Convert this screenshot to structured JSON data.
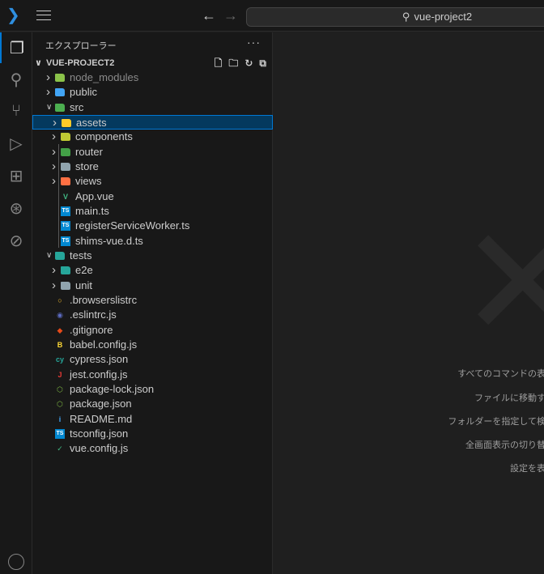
{
  "titlebar": {
    "search_text": "vue-project2",
    "back_icon": "arrow-left-icon",
    "forward_icon": "arrow-right-icon"
  },
  "activity_bar": [
    "explorer-icon",
    "search-icon",
    "source-control-icon",
    "run-debug-icon",
    "extensions-icon",
    "git-graph-icon",
    "remote-icon"
  ],
  "explorer": {
    "title": "エクスプローラー",
    "more": "···",
    "root": "VUE-PROJECT2",
    "items": [
      {
        "label": "node_modules",
        "level": 1,
        "type": "folder",
        "expanded": false,
        "color": "#8bc34a",
        "dim": true
      },
      {
        "label": "public",
        "level": 1,
        "type": "folder",
        "expanded": false,
        "color": "#42a5f5"
      },
      {
        "label": "src",
        "level": 1,
        "type": "folder",
        "expanded": true,
        "color": "#4caf50"
      },
      {
        "label": "assets",
        "level": 2,
        "type": "folder",
        "expanded": false,
        "color": "#ffca28",
        "selected": true
      },
      {
        "label": "components",
        "level": 2,
        "type": "folder",
        "expanded": false,
        "color": "#c0ca33"
      },
      {
        "label": "router",
        "level": 2,
        "type": "folder",
        "expanded": false,
        "color": "#43a047"
      },
      {
        "label": "store",
        "level": 2,
        "type": "folder",
        "expanded": false,
        "color": "#90a4ae"
      },
      {
        "label": "views",
        "level": 2,
        "type": "folder",
        "expanded": false,
        "color": "#ff7043"
      },
      {
        "label": "App.vue",
        "level": 2,
        "type": "file",
        "glyph": "V",
        "color": "#41b883"
      },
      {
        "label": "main.ts",
        "level": 2,
        "type": "file",
        "glyph": "TS",
        "color": "#0288d1"
      },
      {
        "label": "registerServiceWorker.ts",
        "level": 2,
        "type": "file",
        "glyph": "TS",
        "color": "#0288d1"
      },
      {
        "label": "shims-vue.d.ts",
        "level": 2,
        "type": "file",
        "glyph": "TS",
        "color": "#0288d1"
      },
      {
        "label": "tests",
        "level": 1,
        "type": "folder",
        "expanded": true,
        "color": "#26a69a"
      },
      {
        "label": "e2e",
        "level": 2,
        "type": "folder",
        "expanded": false,
        "color": "#26a69a"
      },
      {
        "label": "unit",
        "level": 2,
        "type": "folder",
        "expanded": false,
        "color": "#90a4ae"
      },
      {
        "label": ".browserslistrc",
        "level": 1,
        "type": "file",
        "glyph": "○",
        "color": "#fbc02d"
      },
      {
        "label": ".eslintrc.js",
        "level": 1,
        "type": "file",
        "glyph": "◉",
        "color": "#5c6bc0"
      },
      {
        "label": ".gitignore",
        "level": 1,
        "type": "file",
        "glyph": "◆",
        "color": "#e64a19"
      },
      {
        "label": "babel.config.js",
        "level": 1,
        "type": "file",
        "glyph": "B",
        "color": "#fdd835"
      },
      {
        "label": "cypress.json",
        "level": 1,
        "type": "file",
        "glyph": "cy",
        "color": "#26a69a"
      },
      {
        "label": "jest.config.js",
        "level": 1,
        "type": "file",
        "glyph": "J",
        "color": "#e53935"
      },
      {
        "label": "package-lock.json",
        "level": 1,
        "type": "file",
        "glyph": "⬡",
        "color": "#7cb342"
      },
      {
        "label": "package.json",
        "level": 1,
        "type": "file",
        "glyph": "⬡",
        "color": "#7cb342"
      },
      {
        "label": "README.md",
        "level": 1,
        "type": "file",
        "glyph": "i",
        "color": "#42a5f5"
      },
      {
        "label": "tsconfig.json",
        "level": 1,
        "type": "file",
        "glyph": "TS",
        "color": "#0288d1"
      },
      {
        "label": "vue.config.js",
        "level": 1,
        "type": "file",
        "glyph": "✓",
        "color": "#41b883"
      }
    ]
  },
  "editor": {
    "hints": [
      "すべてのコマンドの表",
      "ファイルに移動す",
      "フォルダーを指定して検",
      "全画面表示の切り替",
      "設定を表"
    ]
  }
}
